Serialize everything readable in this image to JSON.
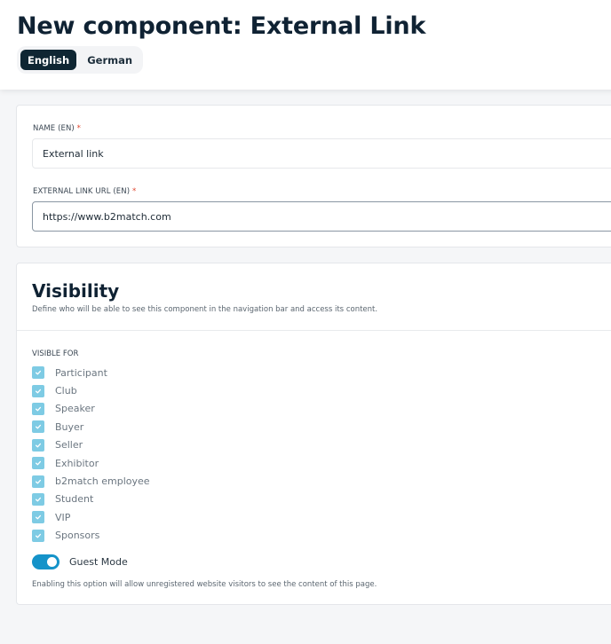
{
  "header": {
    "title": "New component: External Link",
    "languages": [
      {
        "label": "English",
        "active": true
      },
      {
        "label": "German",
        "active": false
      }
    ]
  },
  "fields": {
    "name": {
      "label": "NAME (EN)",
      "required_mark": "*",
      "value": "External link"
    },
    "url": {
      "label": "EXTERNAL LINK URL (EN)",
      "required_mark": "*",
      "value": "https://www.b2match.com"
    }
  },
  "visibility": {
    "title": "Visibility",
    "description": "Define who will be able to see this component in the navigation bar and access its content.",
    "visible_for_label": "VISIBLE FOR",
    "roles": [
      {
        "label": "Participant",
        "checked": true
      },
      {
        "label": "Club",
        "checked": true
      },
      {
        "label": "Speaker",
        "checked": true
      },
      {
        "label": "Buyer",
        "checked": true
      },
      {
        "label": "Seller",
        "checked": true
      },
      {
        "label": "Exhibitor",
        "checked": true
      },
      {
        "label": "b2match employee",
        "checked": true
      },
      {
        "label": "Student",
        "checked": true
      },
      {
        "label": "VIP",
        "checked": true
      },
      {
        "label": "Sponsors",
        "checked": true
      }
    ],
    "guest_mode": {
      "label": "Guest Mode",
      "enabled": true,
      "help": "Enabling this option will allow unregistered website visitors to see the content of this page."
    }
  },
  "colors": {
    "accent": "#1593c9",
    "checkbox": "#7ecbe4",
    "dark": "#0f2633",
    "required": "#e0462f"
  }
}
